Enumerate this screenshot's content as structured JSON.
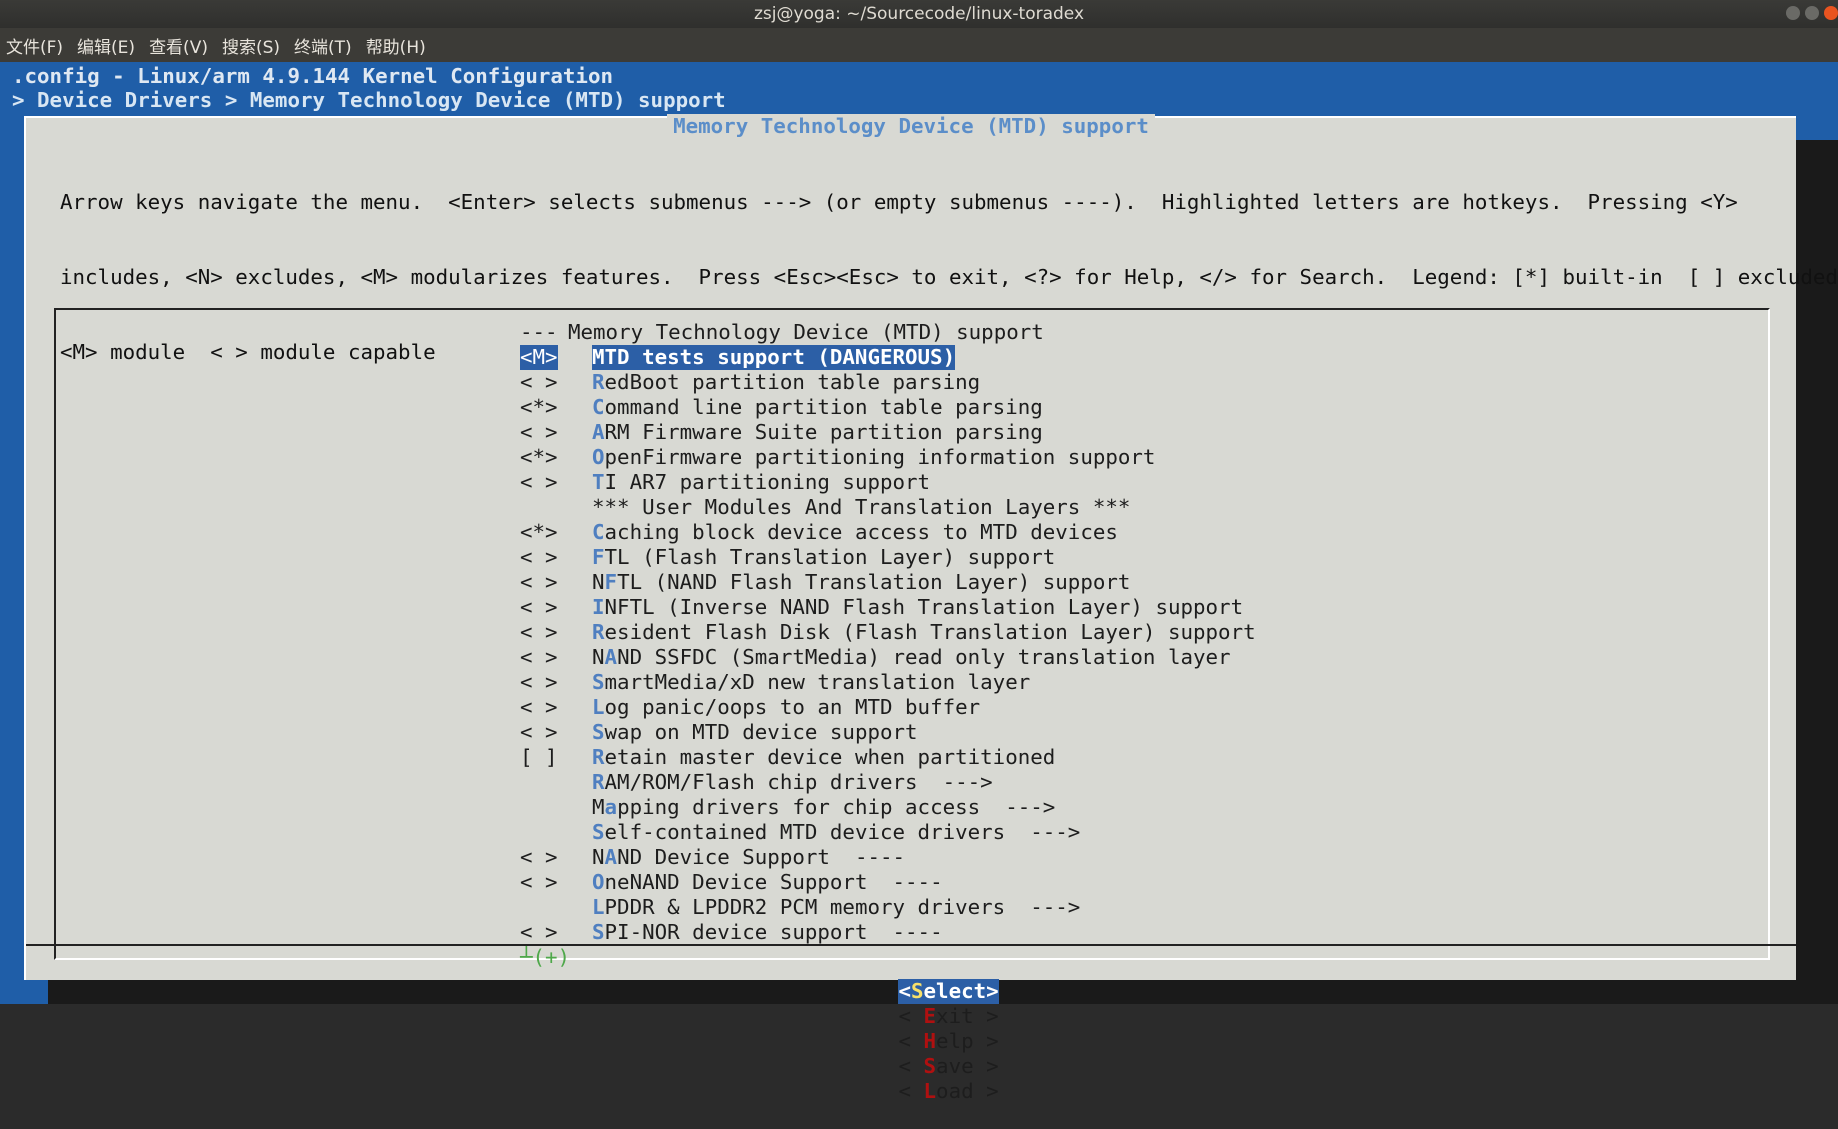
{
  "window": {
    "title": "zsj@yoga: ~/Sourcecode/linux-toradex"
  },
  "menubar": {
    "file": "文件(F)",
    "edit": "编辑(E)",
    "view": "查看(V)",
    "search": "搜索(S)",
    "terminal": "终端(T)",
    "help": "帮助(H)"
  },
  "terminal": {
    "config_line": ".config - Linux/arm 4.9.144 Kernel Configuration",
    "breadcrumb": "> Device Drivers > Memory Technology Device (MTD) support",
    "dialog_title": "Memory Technology Device (MTD) support",
    "help_lines": [
      "Arrow keys navigate the menu.  <Enter> selects submenus ---> (or empty submenus ----).  Highlighted letters are hotkeys.  Pressing <Y>",
      "includes, <N> excludes, <M> modularizes features.  Press <Esc><Esc> to exit, <?> for Help, </> for Search.  Legend: [*] built-in  [ ] excluded",
      "<M> module  < > module capable"
    ],
    "items": [
      {
        "flag": "---",
        "text": "Memory Technology Device (MTD) support",
        "hk": ""
      },
      {
        "flag": "<M>",
        "text": "MTD tests support (DANGEROUS)",
        "hk": "T",
        "selected": true
      },
      {
        "flag": "< >",
        "text": "RedBoot partition table parsing",
        "hk": "R"
      },
      {
        "flag": "<*>",
        "text": "Command line partition table parsing",
        "hk": "C"
      },
      {
        "flag": "< >",
        "text": "ARM Firmware Suite partition parsing",
        "hk": "A"
      },
      {
        "flag": "<*>",
        "text": "OpenFirmware partitioning information support",
        "hk": "O"
      },
      {
        "flag": "< >",
        "text": "TI AR7 partitioning support",
        "hk": "T"
      },
      {
        "flag": "",
        "text": "*** User Modules And Translation Layers ***",
        "hk": ""
      },
      {
        "flag": "<*>",
        "text": "Caching block device access to MTD devices",
        "hk": "C"
      },
      {
        "flag": "< >",
        "text": "FTL (Flash Translation Layer) support",
        "hk": "F"
      },
      {
        "flag": "< >",
        "text": "NFTL (NAND Flash Translation Layer) support",
        "hk": "F"
      },
      {
        "flag": "< >",
        "text": "INFTL (Inverse NAND Flash Translation Layer) support",
        "hk": "I"
      },
      {
        "flag": "< >",
        "text": "Resident Flash Disk (Flash Translation Layer) support",
        "hk": "R"
      },
      {
        "flag": "< >",
        "text": "NAND SSFDC (SmartMedia) read only translation layer",
        "hk": "A"
      },
      {
        "flag": "< >",
        "text": "SmartMedia/xD new translation layer",
        "hk": "S"
      },
      {
        "flag": "< >",
        "text": "Log panic/oops to an MTD buffer",
        "hk": "L"
      },
      {
        "flag": "< >",
        "text": "Swap on MTD device support",
        "hk": "S"
      },
      {
        "flag": "[ ]",
        "text": "Retain master device when partitioned",
        "hk": "R"
      },
      {
        "flag": "",
        "text": "RAM/ROM/Flash chip drivers  --->",
        "hk": "R"
      },
      {
        "flag": "",
        "text": "Mapping drivers for chip access  --->",
        "hk": "a"
      },
      {
        "flag": "",
        "text": "Self-contained MTD device drivers  --->",
        "hk": "S"
      },
      {
        "flag": "< >",
        "text": "NAND Device Support  ----",
        "hk": "A"
      },
      {
        "flag": "< >",
        "text": "OneNAND Device Support  ----",
        "hk": "O"
      },
      {
        "flag": "",
        "text": "LPDDR & LPDDR2 PCM memory drivers  --->",
        "hk": "L"
      },
      {
        "flag": "< >",
        "text": "SPI-NOR device support  ----",
        "hk": "S"
      }
    ],
    "more_indicator": "┴(+)",
    "buttons": {
      "select": "<Select>",
      "exit": "< Exit >",
      "help": "< Help >",
      "save": "< Save >",
      "load": "< Load >"
    }
  }
}
